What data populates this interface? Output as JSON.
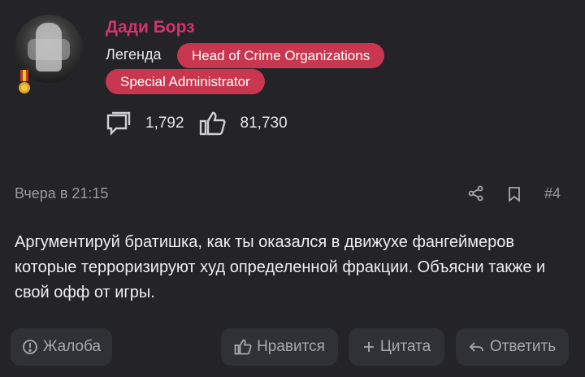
{
  "post": {
    "author": {
      "name": "Дади Борз",
      "title": "Легенда",
      "badges": [
        "Head of Crime Organizations",
        "Special Administrator"
      ],
      "messages_count": "1,792",
      "likes_count": "81,730"
    },
    "date": "Вчера в 21:15",
    "number": "#4",
    "text": "Аргументируй братишка, как ты оказался в движухе фангеймеров которые терроризируют худ определенной фракции. Объясни также и свой офф от игры."
  },
  "actions": {
    "report": "Жалоба",
    "like": "Нравится",
    "quote": "Цитата",
    "reply": "Ответить"
  },
  "colors": {
    "background": "#232328",
    "username": "#d4336e",
    "badge": "#c8374f",
    "button_bg": "#303037"
  },
  "icons": [
    "avatar",
    "medal-icon",
    "messages-icon",
    "likes-icon",
    "share-icon",
    "bookmark-icon",
    "report-icon",
    "like-icon",
    "plus-icon",
    "reply-icon"
  ]
}
